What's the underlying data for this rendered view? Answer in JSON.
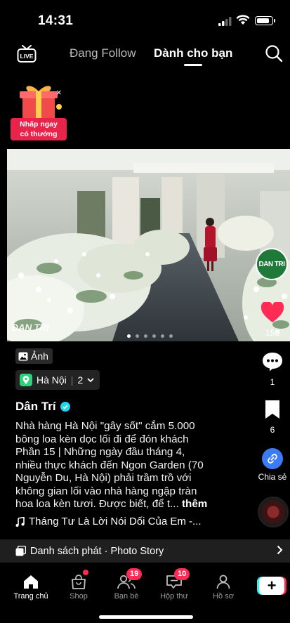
{
  "status_bar": {
    "time": "14:31"
  },
  "top_nav": {
    "live_label": "LIVE",
    "tab_following": "Đang Follow",
    "tab_foryou": "Dành cho bạn"
  },
  "promo": {
    "line1": "Nhấp ngay",
    "line2": "có thưởng",
    "close": "×"
  },
  "photo": {
    "watermark": "DAN TRI",
    "page_indicator": {
      "count": 6,
      "active_index": 0
    }
  },
  "right_rail": {
    "author_avatar_text": "DAN TRI",
    "likes": "158",
    "comments": "1",
    "saves": "6",
    "share_label": "Chia sẻ"
  },
  "post": {
    "type_badge": "Ảnh",
    "location": "Hà Nội",
    "location_count": "2",
    "author": "Dân Trí",
    "caption_lines": [
      "Nhà hàng Hà Nội \"gây sốt\" cắm 5.000",
      "bông loa kèn dọc lối đi để đón khách",
      "Phần 15 | Những ngày đầu tháng 4,",
      "nhiều thực khách đến Ngon Garden (70",
      "Nguyễn Du, Hà Nội) phải trầm trồ với",
      "không gian lối vào nhà hàng ngập tràn",
      "hoa loa kèn tươi.  Được biết, để t..."
    ],
    "more_label": "thêm",
    "music": "Tháng Tư Là Lời Nói Dối Của Em -..."
  },
  "playlist": {
    "label": "Danh sách phát · Photo Story"
  },
  "bottom_nav": {
    "home": "Trang chủ",
    "shop": "Shop",
    "friends": "Bạn bè",
    "friends_badge": "19",
    "inbox": "Hộp thư",
    "inbox_badge": "10",
    "profile": "Hồ sơ"
  },
  "colors": {
    "like": "#fe2c55",
    "share": "#3b7cf5",
    "verified": "#20d5ec",
    "location_pin": "#2ad27a",
    "promo": "#e8244b"
  }
}
